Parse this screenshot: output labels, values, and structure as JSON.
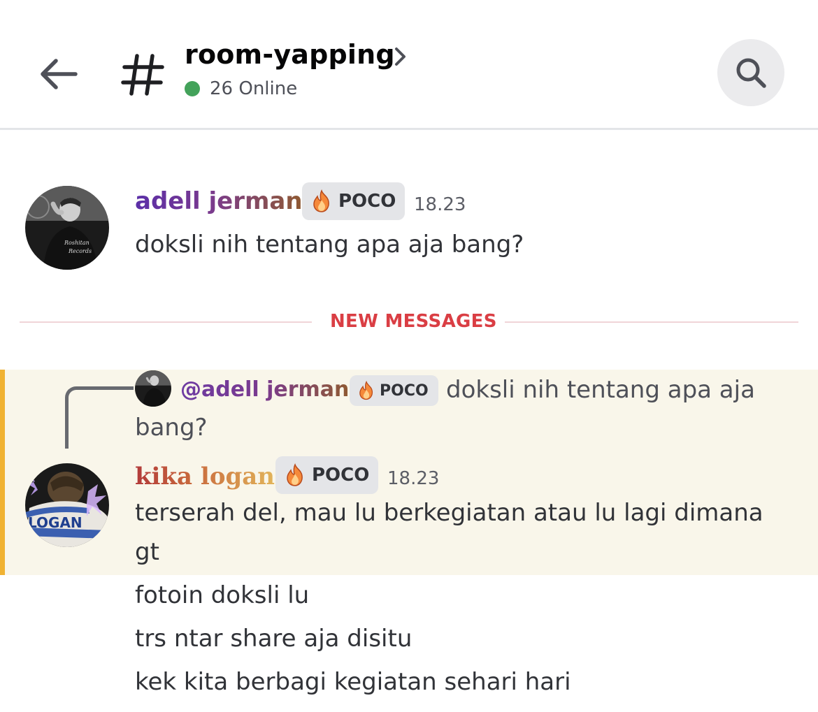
{
  "header": {
    "channel_name": "room-yapping",
    "online_text": "26 Online"
  },
  "messages": [
    {
      "author": "adell jerman",
      "tag": "POCO",
      "time": "18.23",
      "lines": [
        "doksli nih tentang apa aja bang?"
      ]
    }
  ],
  "divider": {
    "label": "NEW MESSAGES"
  },
  "reply": {
    "mention": "@adell jerman",
    "tag": "POCO",
    "text_line1": "doksli nih tentang apa aja",
    "text_line2": "bang?"
  },
  "reply_message": {
    "author": "kika logan",
    "tag": "POCO",
    "time": "18.23",
    "lines": [
      "terserah del, mau lu berkegiatan atau lu lagi dimana",
      "gt",
      "fotoin doksli lu",
      "trs ntar share aja disitu",
      "kek kita berbagi kegiatan sehari hari"
    ]
  },
  "colors": {
    "online": "#43a25a",
    "new_messages": "#da3e44",
    "highlight_bg": "#f9f6ea",
    "highlight_bar": "#f0b232"
  },
  "icons": [
    "back-arrow-icon",
    "hash-icon",
    "chevron-right-icon",
    "search-icon",
    "fire-icon"
  ]
}
